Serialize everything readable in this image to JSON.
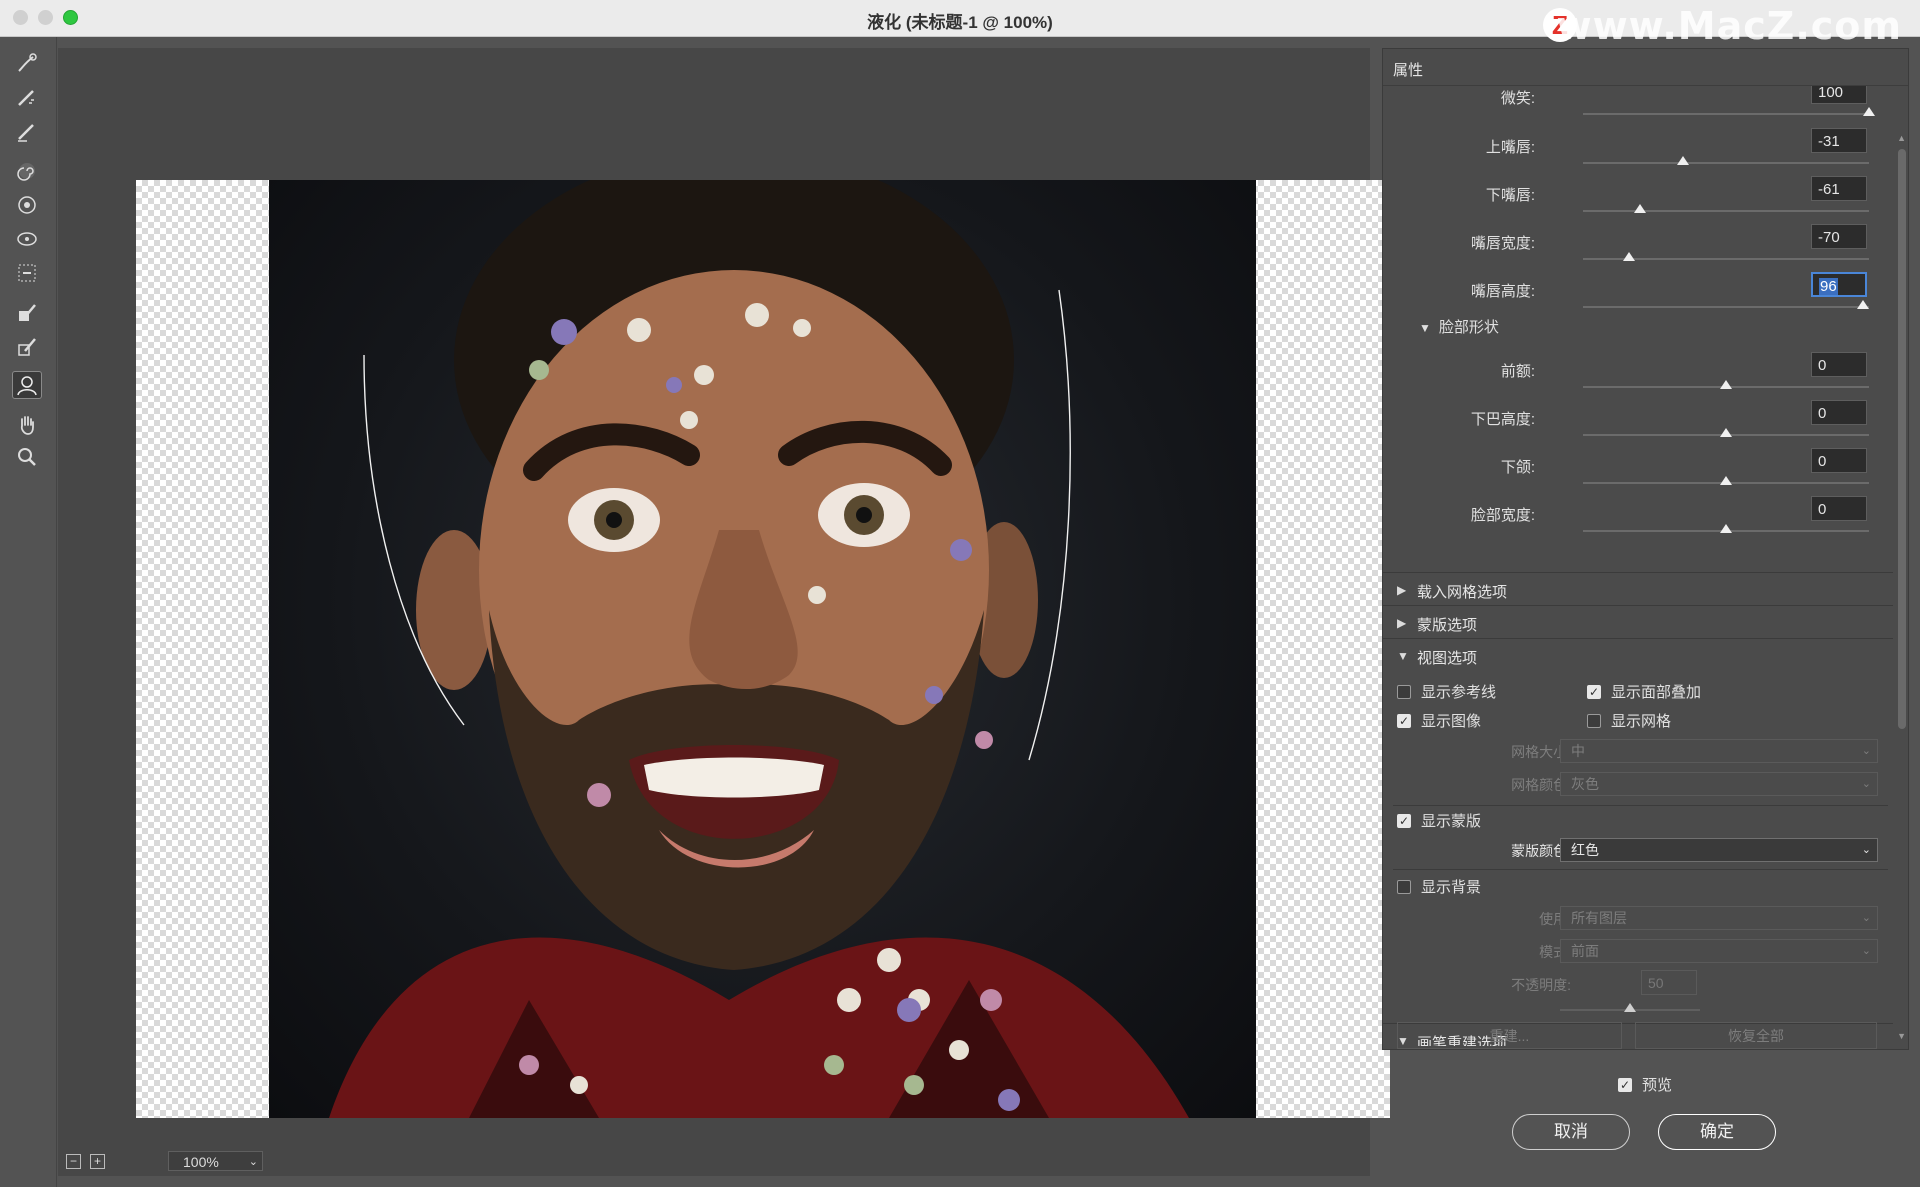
{
  "window": {
    "title": "液化 (未标题-1 @ 100%)",
    "watermark": "www.MacZ.com",
    "watermark_logo": "Z"
  },
  "toolbar": {
    "tools": [
      "forward-warp-tool",
      "reconstruct-tool",
      "smooth-tool",
      "twirl-clockwise-tool",
      "pucker-tool",
      "bloat-tool",
      "push-left-tool",
      "freeze-mask-tool",
      "thaw-mask-tool",
      "face-tool",
      "hand-tool",
      "zoom-tool"
    ],
    "active": "face-tool"
  },
  "canvas": {
    "zoom": "100%",
    "zoom_minus": "−",
    "zoom_plus": "+"
  },
  "panel": {
    "title": "属性",
    "sliders": [
      {
        "label": "微笑:",
        "value": "100",
        "pos": 1.0
      },
      {
        "label": "上嘴唇:",
        "value": "-31",
        "pos": 0.35
      },
      {
        "label": "下嘴唇:",
        "value": "-61",
        "pos": 0.2
      },
      {
        "label": "嘴唇宽度:",
        "value": "-70",
        "pos": 0.16
      },
      {
        "label": "嘴唇高度:",
        "value": "96",
        "pos": 0.98
      }
    ],
    "face_shape_header": "脸部形状",
    "face_sliders": [
      {
        "label": "前额:",
        "value": "0",
        "pos": 0.5
      },
      {
        "label": "下巴高度:",
        "value": "0",
        "pos": 0.5
      },
      {
        "label": "下颌:",
        "value": "0",
        "pos": 0.5
      },
      {
        "label": "脸部宽度:",
        "value": "0",
        "pos": 0.5
      }
    ],
    "sections": {
      "load_mesh": "载入网格选项",
      "mask": "蒙版选项",
      "view": "视图选项",
      "brush_reconstruct": "画笔重建选项"
    },
    "view": {
      "show_guides": {
        "label": "显示参考线",
        "checked": false
      },
      "show_face_overlay": {
        "label": "显示面部叠加",
        "checked": true
      },
      "show_image": {
        "label": "显示图像",
        "checked": true
      },
      "show_mesh": {
        "label": "显示网格",
        "checked": false
      },
      "mesh_size_label": "网格大小:",
      "mesh_size_value": "中",
      "mesh_color_label": "网格颜色:",
      "mesh_color_value": "灰色",
      "show_mask": {
        "label": "显示蒙版",
        "checked": true
      },
      "mask_color_label": "蒙版颜色:",
      "mask_color_value": "红色",
      "show_backdrop": {
        "label": "显示背景",
        "checked": false
      },
      "use_label": "使用:",
      "use_value": "所有图层",
      "mode_label": "模式:",
      "mode_value": "前面",
      "opacity_label": "不透明度:",
      "opacity_value": "50",
      "opacity_pos": 0.5
    },
    "brush": {
      "reconstruct_button": "重建...",
      "restore_all_button": "恢复全部"
    }
  },
  "dialog": {
    "preview": {
      "label": "预览",
      "checked": true
    },
    "cancel": "取消",
    "ok": "确定"
  },
  "colors": {
    "accent": "#3b6fc0",
    "close": "#d0d0d0",
    "maximize": "#2ec740"
  }
}
